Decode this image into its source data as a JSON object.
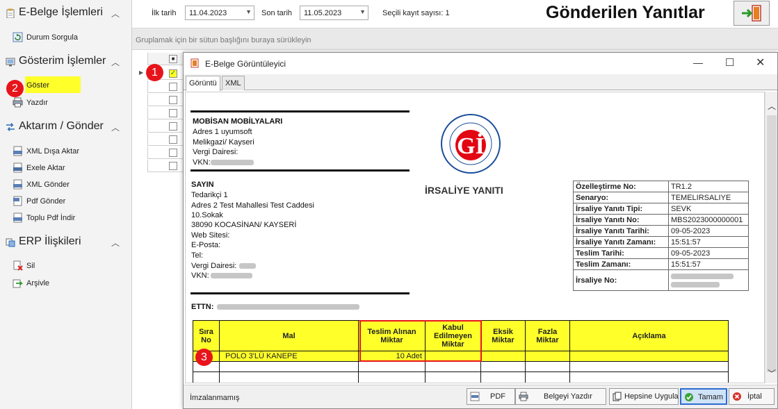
{
  "sidebar": {
    "groups": [
      {
        "title": "E-Belge İşlemleri",
        "items": [
          {
            "label": "Durum Sorgula"
          }
        ]
      },
      {
        "title": "Gösterim İşlemler",
        "items": [
          {
            "label": "Göster"
          },
          {
            "label": "Yazdır"
          }
        ]
      },
      {
        "title": "Aktarım / Gönder",
        "items": [
          {
            "label": "XML Dışa Aktar"
          },
          {
            "label": "Exele Aktar"
          },
          {
            "label": "XML Gönder"
          },
          {
            "label": "Pdf Gönder"
          },
          {
            "label": "Toplu Pdf İndir"
          }
        ]
      },
      {
        "title": "ERP İlişkileri",
        "items": [
          {
            "label": "Sil"
          },
          {
            "label": "Arşivle"
          }
        ]
      }
    ]
  },
  "topbar": {
    "start_label": "İlk tarih",
    "start_value": "11.04.2023",
    "end_label": "Son tarih",
    "end_value": "11.05.2023",
    "selected_count_label": "Seçili kayıt sayısı: 1",
    "page_title": "Gönderilen Yanıtlar"
  },
  "grid": {
    "group_hint": "Gruplamak için bir sütun başlığını buraya sürükleyin"
  },
  "markers": [
    "1",
    "2",
    "3"
  ],
  "dialog": {
    "title": "E-Belge Görüntüleyici",
    "tabs": [
      "Görüntü",
      "XML"
    ],
    "document": {
      "sender_name": "MOBİSAN MOBİLYALARI",
      "sender_address_1": "Adres 1 uyumsoft",
      "sender_address_2": " Melikgazi/ Kayseri",
      "sender_tax_office": "Vergi Dairesi:",
      "sender_vkn": "VKN:",
      "to_label": "SAYIN",
      "receiver_name": "Tedarikçi 1",
      "receiver_address_1": "Adres 2 Test Mahallesi Test Caddesi",
      "receiver_address_2": "10.Sokak",
      "receiver_address_3": "38090 KOCASİNAN/ KAYSERİ",
      "receiver_web": "Web Sitesi:",
      "receiver_email": "E-Posta:",
      "receiver_tel": "Tel:",
      "receiver_tax_office": "Vergi Dairesi:",
      "receiver_vkn": "VKN:",
      "ettn_label": "ETTN:",
      "doc_title": "İRSALİYE YANITI",
      "info_rows": [
        {
          "k": "Özelleştirme No:",
          "v": "TR1.2"
        },
        {
          "k": "Senaryo:",
          "v": "TEMELIRSALIYE"
        },
        {
          "k": "İrsaliye Yanıtı Tipi:",
          "v": "SEVK"
        },
        {
          "k": "İrsaliye Yanıtı No:",
          "v": "MBS2023000000001"
        },
        {
          "k": "İrsaliye Yanıtı Tarihi:",
          "v": "09-05-2023"
        },
        {
          "k": "İrsaliye Yanıtı Zamanı:",
          "v": "15:51:57"
        },
        {
          "k": "Teslim Tarihi:",
          "v": "09-05-2023"
        },
        {
          "k": "Teslim Zamanı:",
          "v": "15:51:57"
        },
        {
          "k": "İrsaliye No:",
          "v": ""
        }
      ],
      "table_headers": [
        "Sıra No",
        "Mal",
        "Teslim Alınan Miktar",
        "Kabul Edilmeyen Miktar",
        "Eksik Miktar",
        "Fazla Miktar",
        "Açıklama"
      ],
      "table_rows": [
        [
          "",
          "POLO 3'LÜ KANEPE",
          "10 Adet",
          "",
          "",
          "",
          ""
        ]
      ]
    },
    "footer": {
      "status": "İmzalanmamış",
      "buttons": [
        "PDF",
        "Belgeyi Yazdır",
        "Hepsine Uygula",
        "Tamam",
        "İptal"
      ]
    }
  },
  "colors": {
    "highlight": "#ffff2a",
    "marker_red": "#e8141b",
    "primary_border": "#2d6ccf"
  }
}
